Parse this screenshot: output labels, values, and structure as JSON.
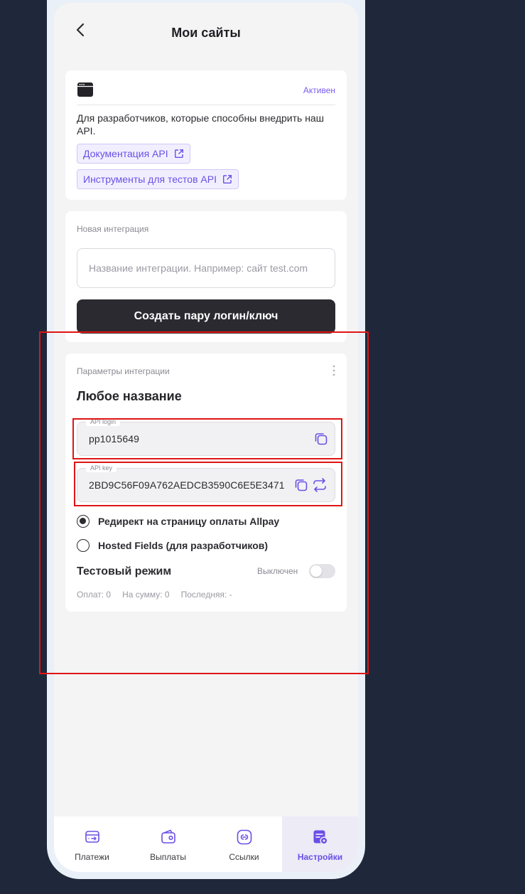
{
  "header": {
    "title": "Мои сайты"
  },
  "api_card": {
    "status": "Активен",
    "description": "Для разработчиков, которые способны внедрить наш API.",
    "docs_link": "Документация API",
    "tools_link": "Инструменты для тестов API",
    "icon": "browser-window-icon"
  },
  "new_integration": {
    "label": "Новая интеграция",
    "placeholder": "Название интеграции. Например: сайт test.com",
    "value": "",
    "button": "Создать пару логин/ключ"
  },
  "integration": {
    "label": "Параметры интеграции",
    "name": "Любое название",
    "login_legend": "API login",
    "login_value": "pp1015649",
    "key_legend": "API key",
    "key_value": "2BD9C56F09A762AEDCB3590C6E5E3471",
    "options": [
      {
        "label": "Редирект на страницу оплаты Allpay",
        "selected": true
      },
      {
        "label": "Hosted Fields (для разработчиков)",
        "selected": false
      }
    ],
    "test_mode": {
      "title": "Тестовый режим",
      "status": "Выключен",
      "enabled": false
    },
    "stats": {
      "payments": "Оплат: 0",
      "sum": "На сумму: 0",
      "last": "Последняя: -"
    }
  },
  "tabs": [
    {
      "label": "Платежи",
      "icon": "card-transfer-icon",
      "active": false
    },
    {
      "label": "Выплаты",
      "icon": "wallet-icon",
      "active": false
    },
    {
      "label": "Ссылки",
      "icon": "link-icon",
      "active": false
    },
    {
      "label": "Настройки",
      "icon": "settings-icon",
      "active": true
    }
  ],
  "colors": {
    "accent": "#6b4fe6",
    "dark_button": "#2b2a30",
    "background": "#1f283a",
    "annotation": "#e01414"
  }
}
